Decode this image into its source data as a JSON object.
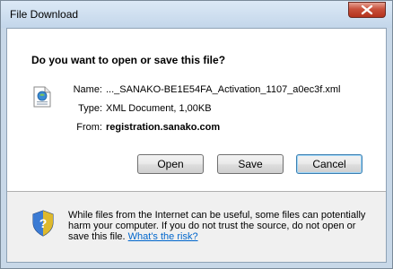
{
  "window": {
    "title": "File Download",
    "close_icon": "close-icon"
  },
  "dialog": {
    "question": "Do you want to open or save this file?",
    "file_icon": "xml-document-icon",
    "details": [
      {
        "label": "Name:",
        "value": "..._SANAKO-BE1E54FA_Activation_1107_a0ec3f.xml"
      },
      {
        "label": "Type:",
        "value": "XML Document, 1,00KB"
      },
      {
        "label": "From:",
        "value": "registration.sanako.com"
      }
    ],
    "buttons": {
      "open": "Open",
      "save": "Save",
      "cancel": "Cancel"
    }
  },
  "warning": {
    "icon": "security-shield-question-icon",
    "text": "While files from the Internet can be useful, some files can potentially harm your computer. If you do not trust the source, do not open or save this file.",
    "link": "What's the risk?"
  },
  "colors": {
    "close_button": "#c8503b",
    "link": "#0066cc",
    "panel_bg": "#f0f0f0",
    "frame": "#c8d8e8"
  }
}
